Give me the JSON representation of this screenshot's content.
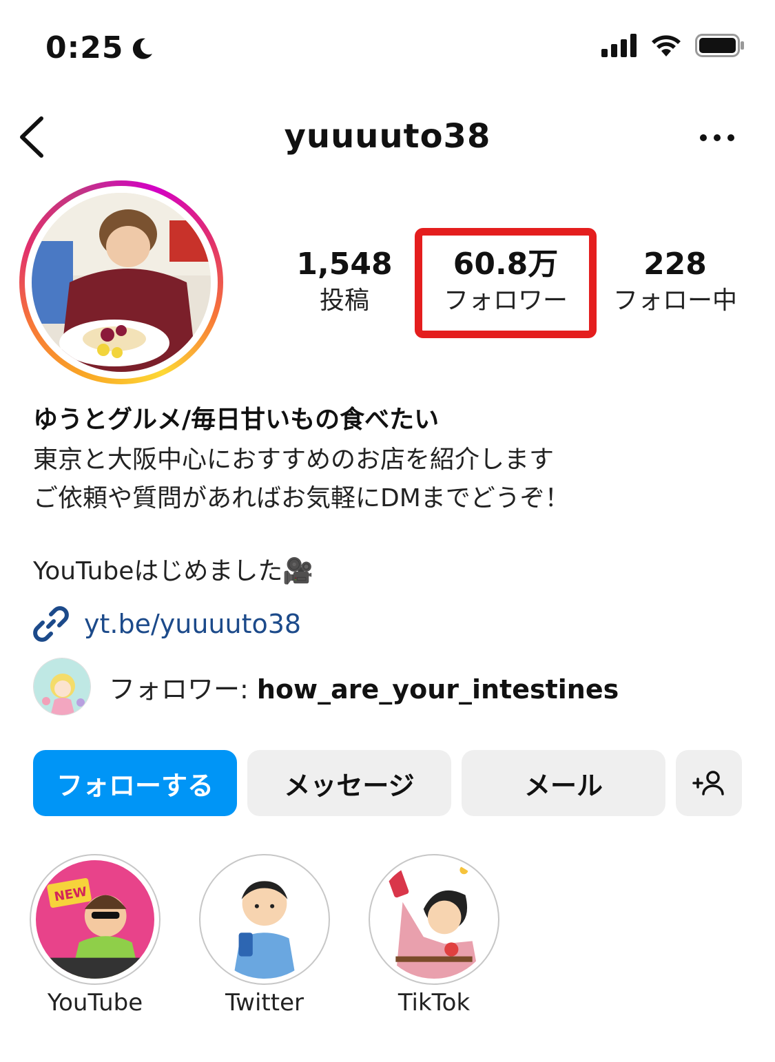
{
  "status_bar": {
    "time": "0:25",
    "icons": [
      "moon-icon",
      "signal-icon",
      "wifi-icon",
      "battery-icon"
    ]
  },
  "nav": {
    "username": "yuuuuto38",
    "back_icon": "chevron-left-icon",
    "more_icon": "more-horizontal-icon"
  },
  "stats": {
    "posts": {
      "value": "1,548",
      "label": "投稿"
    },
    "followers": {
      "value": "60.8万",
      "label": "フォロワー"
    },
    "following": {
      "value": "228",
      "label": "フォロー中"
    }
  },
  "bio": {
    "name": "ゆうとグルメ/毎日甘いもの食べたい",
    "lines": [
      "東京と大阪中心におすすめのお店を紹介します",
      "ご依頼や質問があればお気軽にDMまでどうぞ！",
      "YouTubeはじめました🎥"
    ],
    "link": "yt.be/yuuuuto38"
  },
  "followed_by": {
    "prefix": "フォロワー: ",
    "user": "how_are_your_intestines"
  },
  "buttons": {
    "follow": "フォローする",
    "message": "メッセージ",
    "mail": "メール"
  },
  "highlights": [
    {
      "label": "YouTube"
    },
    {
      "label": "Twitter"
    },
    {
      "label": "TikTok"
    }
  ],
  "colors": {
    "follow_button": "#0095f6",
    "highlight_box": "#e41e1e",
    "link": "#1c4a8a"
  }
}
